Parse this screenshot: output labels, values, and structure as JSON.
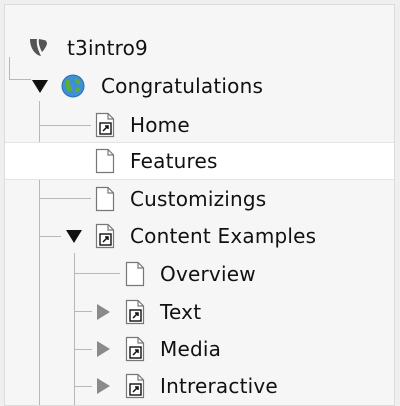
{
  "tree": {
    "root": {
      "label": "t3intro9",
      "icon": "typo3-logo-icon"
    },
    "items": [
      {
        "label": "Congratulations",
        "icon": "globe-icon",
        "toggle": "expanded"
      },
      {
        "label": "Home",
        "icon": "page-shortcut-icon"
      },
      {
        "label": "Features",
        "icon": "page-icon",
        "selected": true
      },
      {
        "label": "Customizings",
        "icon": "page-icon"
      },
      {
        "label": "Content Examples",
        "icon": "page-shortcut-icon",
        "toggle": "expanded"
      },
      {
        "label": "Overview",
        "icon": "page-icon"
      },
      {
        "label": "Text",
        "icon": "page-shortcut-icon",
        "toggle": "collapsed"
      },
      {
        "label": "Media",
        "icon": "page-shortcut-icon",
        "toggle": "collapsed"
      },
      {
        "label": "Intreractive",
        "icon": "page-shortcut-icon",
        "toggle": "collapsed"
      }
    ]
  },
  "colors": {
    "panel_background": "#f6f6f6",
    "selected_row": "#ffffff",
    "tree_lines": "#b8b8b8",
    "toggle_expanded": "#111111",
    "toggle_collapsed": "#8a8a8a"
  }
}
